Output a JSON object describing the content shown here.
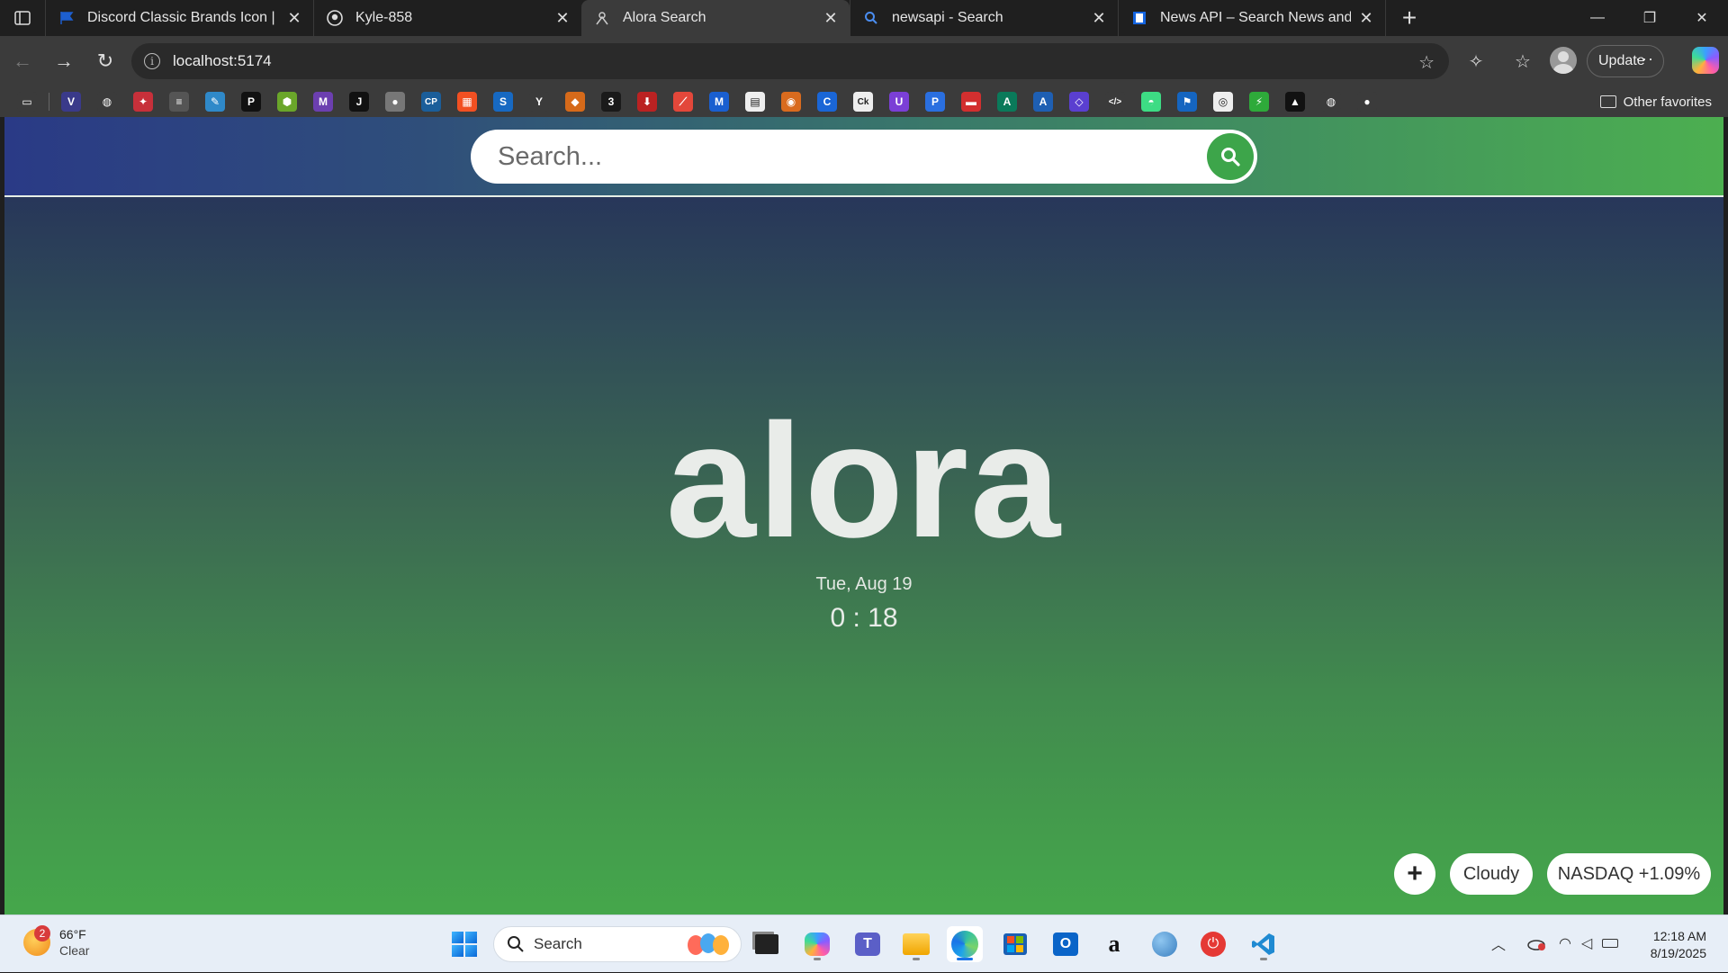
{
  "browser": {
    "tabs": [
      {
        "title": "Discord Classic Brands Icon | Font",
        "active": false
      },
      {
        "title": "Kyle-858",
        "active": false
      },
      {
        "title": "Alora Search",
        "active": true
      },
      {
        "title": "newsapi - Search",
        "active": false
      },
      {
        "title": "News API – Search News and Blog",
        "active": false
      }
    ],
    "address": "localhost:5174",
    "update_label": "Update",
    "other_favorites_label": "Other favorites"
  },
  "bookmarks": [
    {
      "icon": "ticket-icon",
      "glyph": "▭",
      "color": "#3b3b3b"
    },
    {
      "icon": "vivaldi-icon",
      "glyph": "V",
      "color": "#3a3a8a"
    },
    {
      "icon": "globe-icon",
      "glyph": "◍",
      "color": "#3b3b3b"
    },
    {
      "icon": "puzzle-icon",
      "glyph": "✦",
      "color": "#c7303a"
    },
    {
      "icon": "doc-icon",
      "glyph": "≡",
      "color": "#555"
    },
    {
      "icon": "draw-icon",
      "glyph": "✎",
      "color": "#2f89c9"
    },
    {
      "icon": "producthunt-icon",
      "glyph": "P",
      "color": "#111"
    },
    {
      "icon": "tool-icon",
      "glyph": "⬢",
      "color": "#6aa62a"
    },
    {
      "icon": "m-icon",
      "glyph": "M",
      "color": "#6c3fb0"
    },
    {
      "icon": "j-icon",
      "glyph": "J",
      "color": "#111"
    },
    {
      "icon": "ollie-icon",
      "glyph": "●",
      "color": "#777"
    },
    {
      "icon": "cp-icon",
      "glyph": "CP",
      "color": "#1b5e9a"
    },
    {
      "icon": "microsoft-icon",
      "glyph": "▦",
      "color": "#f25022"
    },
    {
      "icon": "s-icon",
      "glyph": "S",
      "color": "#1769c2"
    },
    {
      "icon": "y-icon",
      "glyph": "Y",
      "color": "#3b3b3b"
    },
    {
      "icon": "fox-icon",
      "glyph": "◆",
      "color": "#d66a1a"
    },
    {
      "icon": "three-icon",
      "glyph": "3",
      "color": "#1a1a1a"
    },
    {
      "icon": "download-icon",
      "glyph": "⬇",
      "color": "#b22"
    },
    {
      "icon": "flame-icon",
      "glyph": "⟋",
      "color": "#e3473a"
    },
    {
      "icon": "mega-icon",
      "glyph": "M",
      "color": "#1a5fd0"
    },
    {
      "icon": "page-icon",
      "glyph": "▤",
      "color": "#eee"
    },
    {
      "icon": "owl-icon",
      "glyph": "◉",
      "color": "#d96b1e"
    },
    {
      "icon": "c-icon",
      "glyph": "C",
      "color": "#1a66d6"
    },
    {
      "icon": "ck-icon",
      "glyph": "Ck",
      "color": "#eee"
    },
    {
      "icon": "u-icon",
      "glyph": "U",
      "color": "#7b3fd6"
    },
    {
      "icon": "p-blue-icon",
      "glyph": "P",
      "color": "#2a6fe0"
    },
    {
      "icon": "pdf-icon",
      "glyph": "▬",
      "color": "#d32f2f"
    },
    {
      "icon": "a-green-icon",
      "glyph": "A",
      "color": "#0a7a5a"
    },
    {
      "icon": "a-blue-icon",
      "glyph": "A",
      "color": "#1e5fb3"
    },
    {
      "icon": "code-purple-icon",
      "glyph": "◇",
      "color": "#5a3fd0"
    },
    {
      "icon": "code-icon",
      "glyph": "</>",
      "color": "#3b3b3b"
    },
    {
      "icon": "android-icon",
      "glyph": "◓",
      "color": "#3ddc84"
    },
    {
      "icon": "flag-icon",
      "glyph": "⚑",
      "color": "#1565c0"
    },
    {
      "icon": "circle-icon",
      "glyph": "◎",
      "color": "#eee"
    },
    {
      "icon": "bolt-icon",
      "glyph": "⚡",
      "color": "#2eaa3a"
    },
    {
      "icon": "triangle-icon",
      "glyph": "▲",
      "color": "#111"
    },
    {
      "icon": "globe2-icon",
      "glyph": "◍",
      "color": "#3b3b3b"
    },
    {
      "icon": "github-icon",
      "glyph": "●",
      "color": "#3b3b3b"
    }
  ],
  "search": {
    "placeholder": "Search..."
  },
  "hero": {
    "logo": "alora",
    "date": "Tue, Aug 19",
    "time": "0 : 18"
  },
  "widgets": {
    "add_label": "+",
    "weather_label": "Cloudy",
    "stock_label": "NASDAQ +1.09%"
  },
  "taskbar": {
    "weather_temp": "66°F",
    "weather_cond": "Clear",
    "weather_badge": "2",
    "search_label": "Search",
    "time": "12:18 AM",
    "date": "8/19/2025"
  },
  "colors": {
    "search_button": "#3da54a",
    "page_top": "#25305a",
    "page_bottom": "#45a74b"
  }
}
